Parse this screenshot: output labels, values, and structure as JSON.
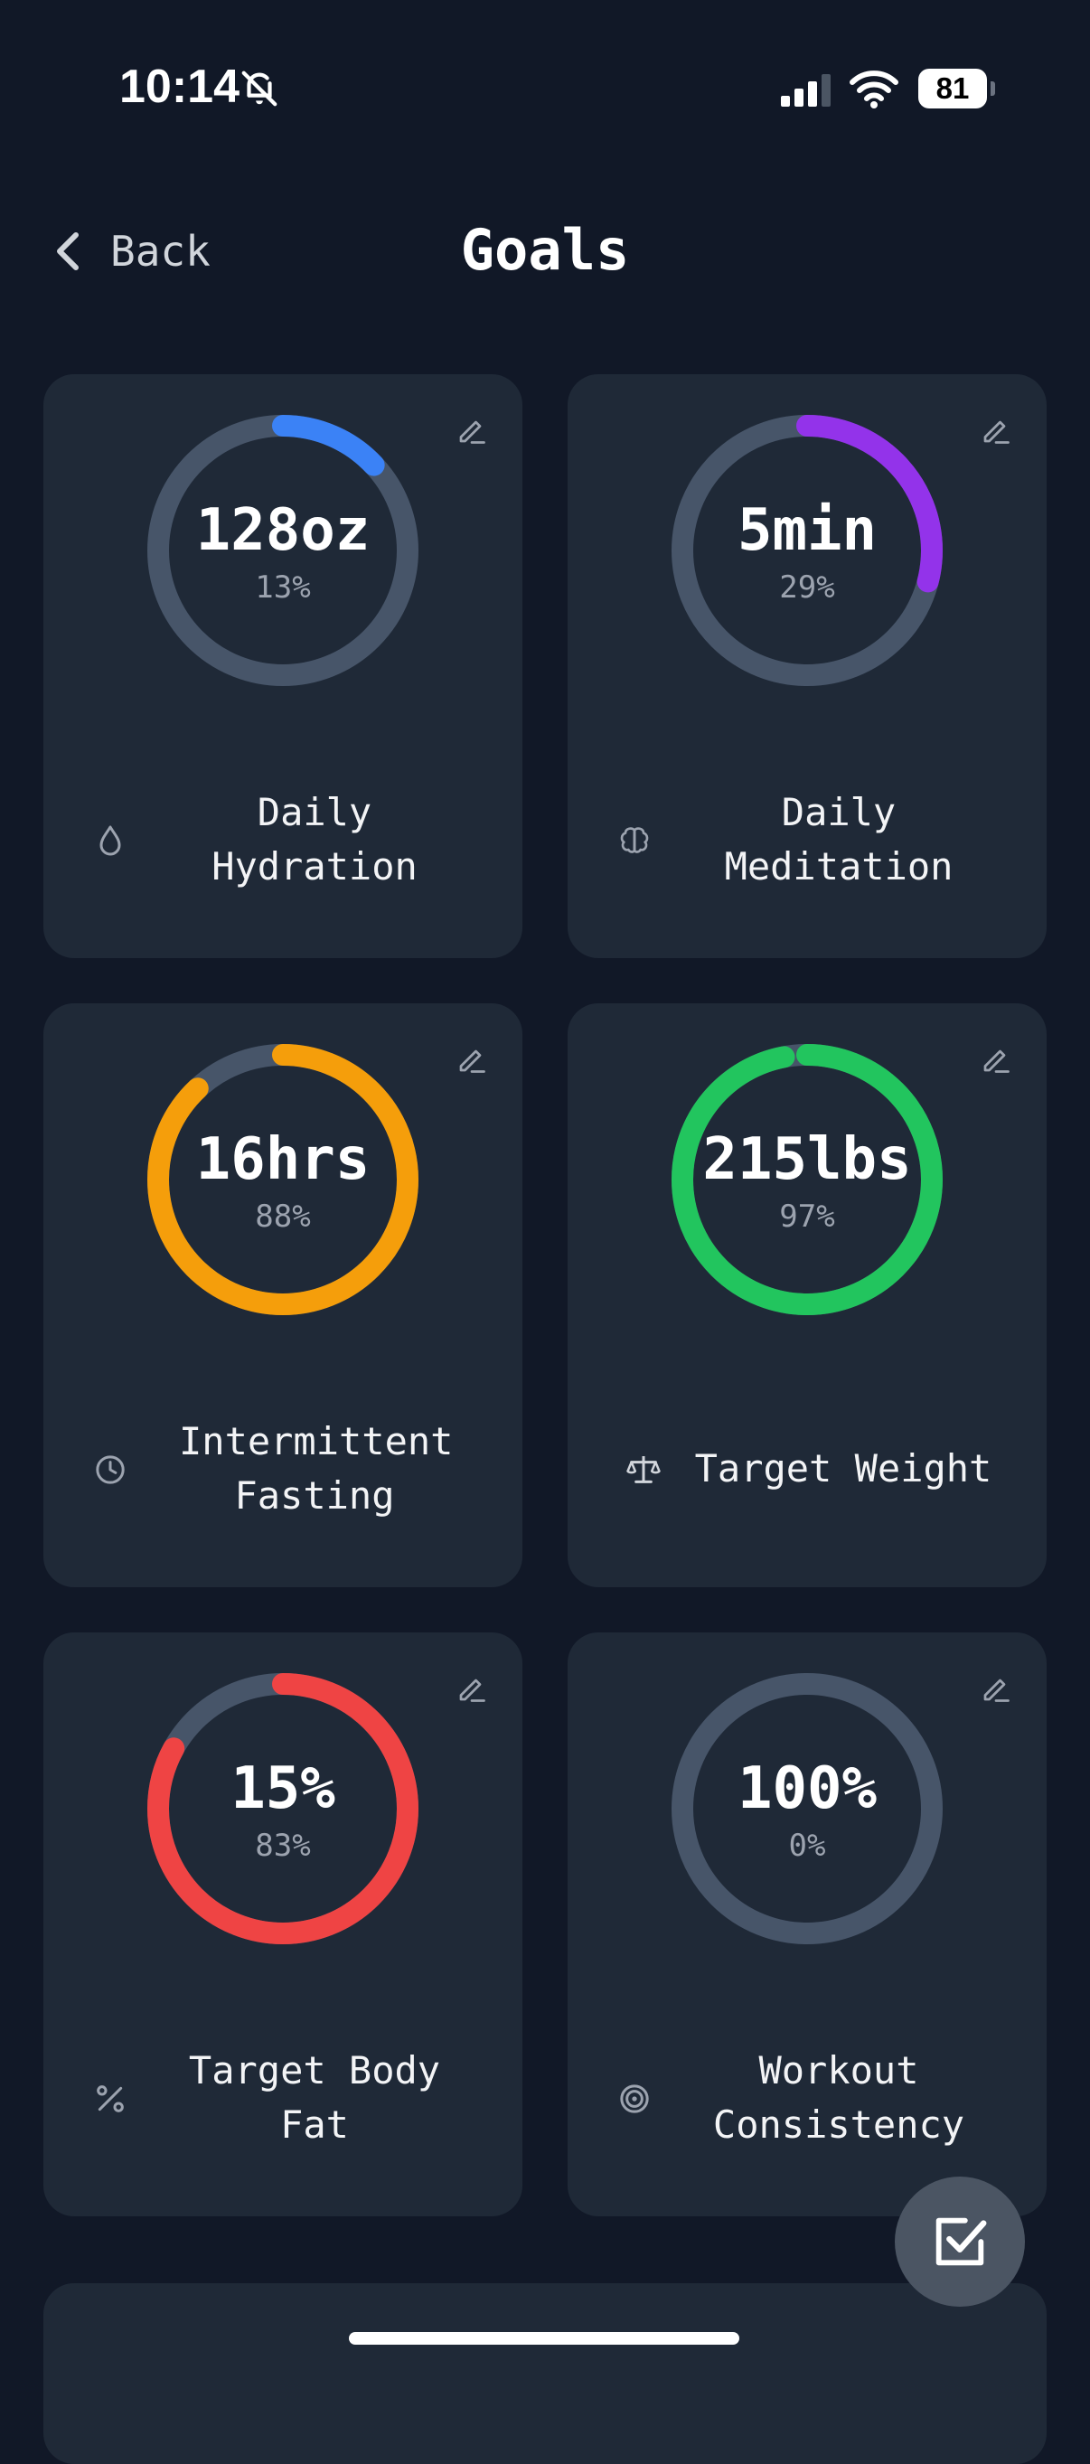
{
  "status_bar": {
    "time": "10:14",
    "battery": "81"
  },
  "nav": {
    "back_label": "Back",
    "title": "Goals"
  },
  "track_color": "#475569",
  "goals": [
    {
      "value": "128oz",
      "percent_label": "13%",
      "progress": 0.13,
      "color": "#3b82f6",
      "label": "Daily Hydration",
      "icon": "water-drop-icon"
    },
    {
      "value": "5min",
      "percent_label": "29%",
      "progress": 0.29,
      "color": "#9333ea",
      "label": "Daily Meditation",
      "icon": "brain-icon"
    },
    {
      "value": "16hrs",
      "percent_label": "88%",
      "progress": 0.88,
      "color": "#f59e0b",
      "label": "Intermittent Fasting",
      "icon": "clock-icon"
    },
    {
      "value": "215lbs",
      "percent_label": "97%",
      "progress": 0.97,
      "color": "#22c55e",
      "label": "Target Weight",
      "icon": "scale-icon"
    },
    {
      "value": "15%",
      "percent_label": "83%",
      "progress": 0.83,
      "color": "#ef4444",
      "label": "Target Body Fat",
      "icon": "percent-icon"
    },
    {
      "value": "100%",
      "percent_label": "0%",
      "progress": 0,
      "color": "#6b7280",
      "label": "Workout Consistency",
      "icon": "target-icon"
    }
  ],
  "fab": {
    "icon": "checkbox-icon"
  }
}
